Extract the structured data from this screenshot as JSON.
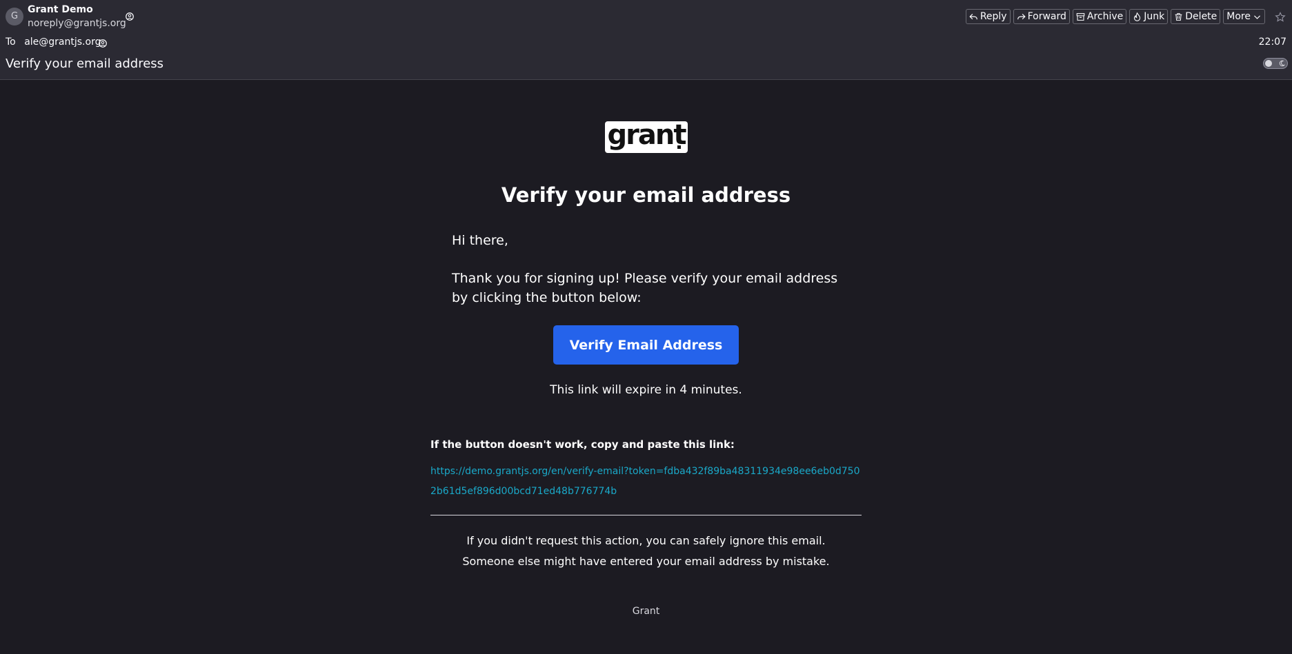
{
  "header": {
    "avatar_letter": "G",
    "sender_name": "Grant Demo",
    "sender_email": "noreply@grantjs.org",
    "to_label": "To",
    "to_address": "ale@grantjs.org",
    "time": "22:07",
    "subject": "Verify your email address",
    "toolbar": {
      "reply": "Reply",
      "forward": "Forward",
      "archive": "Archive",
      "junk": "Junk",
      "delete": "Delete",
      "more": "More"
    }
  },
  "email": {
    "logo_text": "grant",
    "title": "Verify your email address",
    "greeting": "Hi there,",
    "intro": "Thank you for signing up! Please verify your email address by clicking the button below:",
    "button_label": "Verify Email Address",
    "expire_note": "This link will expire in 4 minutes.",
    "fallback_label": "If the button doesn't work, copy and paste this link:",
    "fallback_link": "https://demo.grantjs.org/en/verify-email?token=fdba432f89ba48311934e98ee6eb0d7502b61d5ef896d00bcd71ed48b776774b",
    "footer_line1": "If you didn't request this action, you can safely ignore this email.",
    "footer_line2": "Someone else might have entered your email address by mistake.",
    "signature": "Grant"
  }
}
